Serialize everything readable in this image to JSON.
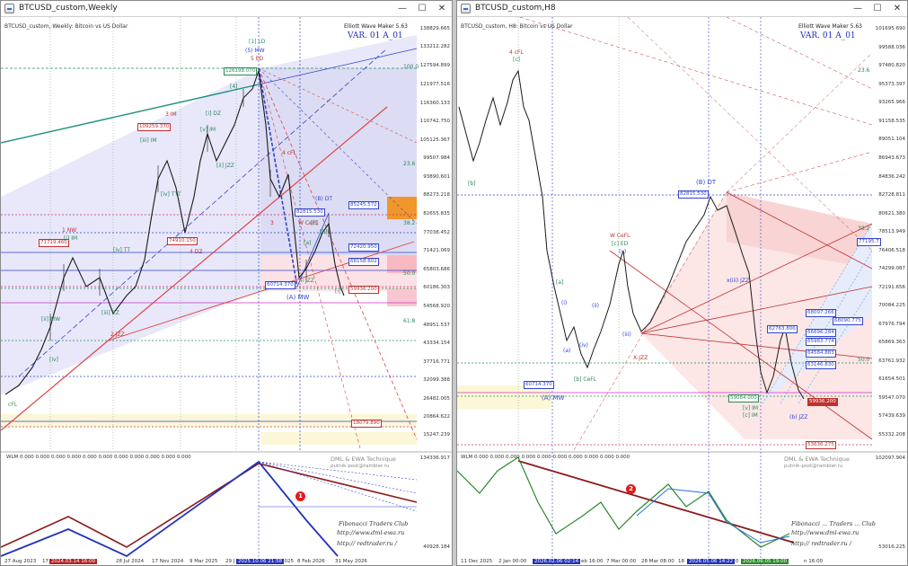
{
  "left": {
    "title": "BTCUSD_custom,Weekly",
    "header": "BTCUSD_custom, Weekly:  Bitcoin vs US Dollar",
    "ewm": "Elliott Wave Maker 5.63",
    "var": "VAR. 01 A_01",
    "prices": [
      "138829.665",
      "133212.282",
      "127594.899",
      "121977.516",
      "116360.133",
      "110742.750",
      "105125.367",
      "99507.984",
      "93890.601",
      "88273.218",
      "82655.835",
      "77038.452",
      "71421.069",
      "65803.686",
      "60186.303",
      "54568.920",
      "48951.537",
      "43334.154",
      "37716.771",
      "32099.388",
      "26482.005",
      "20864.622",
      "15247.239"
    ],
    "fib": [
      "100.0",
      "23.6",
      "38.2",
      "50.0",
      "61.8"
    ],
    "dates": [
      "27 Aug 2023",
      "17",
      "2024.03.14 16:00",
      "28 Jul 2024",
      "17 Nov 2024",
      "9 Mar 2025",
      "29 J",
      "2025.10.06 21:58",
      "2025",
      "8 Feb 2026",
      "31 May 2026"
    ],
    "boxes": {
      "b1": "126198.070",
      "b2": "109259.370",
      "b3": "71719.460",
      "b4": "74910.150",
      "b5": "82815.530",
      "b6": "85245.572",
      "b7": "72420.950",
      "b8": "68158.602",
      "b9": "60714.370",
      "b10": "59936.200",
      "b11": "18079.890"
    },
    "waves": {
      "w1": "[1] LD",
      "w2": "(5) MW",
      "w3": "5 ED",
      "w4": "3 IM",
      "w5": "[iii] IM",
      "w6": "[i] DZ",
      "w7": "[ii] JZZ",
      "w8": "[iv] TTT",
      "w9": "1 NW",
      "w10": "[i] IM",
      "w11": "4 cFL",
      "w12": "(B) DT",
      "w13": "W CeFL",
      "w14": "(A) MW",
      "w15": "2 JZZ",
      "w16": "[ii] MW",
      "w17": "4 DZ",
      "w18": "[iii] ZZ",
      "w19": "[iv] TT",
      "w20": "[v] IM",
      "w21": "cFL",
      "w22": "3",
      "w23": "iii JZZ",
      "w24": "[4]",
      "w25": "[iv]",
      "w26": "[b]",
      "w27": "[c]",
      "w28": "[a]",
      "w29": "[i]"
    },
    "ind_label": "WLM 0.000 0.000 0.000 0.000 0.000 0.000 0.000 0.000 0.000 0.000 0.000",
    "ind_prices": [
      "134336.917",
      "40928.184"
    ],
    "credit": {
      "a": "DML & EWA Technique",
      "b": "putnik-post@rambler.ru",
      "c": "Fibonacci    Traders    Club",
      "d": "http://www.dml-ewa.ru",
      "e": "http:// redtrader.ru /"
    },
    "marker": "1"
  },
  "right": {
    "title": "BTCUSD_custom,H8",
    "header": "BTCUSD_custom, H8:  Bitcoin vs US Dollar",
    "ewm": "Elliott Wave Maker 5.63",
    "var": "VAR. 01 A_01",
    "prices": [
      "101695.690",
      "99588.036",
      "97480.820",
      "95373.397",
      "93265.966",
      "91158.535",
      "89051.104",
      "86943.673",
      "84836.242",
      "82728.811",
      "80621.380",
      "78513.949",
      "76406.518",
      "74299.087",
      "72191.656",
      "70084.225",
      "67976.794",
      "65869.363",
      "63761.932",
      "61654.501",
      "59547.070",
      "57439.639",
      "55332.208"
    ],
    "fib": [
      "23.6",
      "38.2",
      "50.0"
    ],
    "dates": [
      "11 Dec 2025",
      "2 Jan 00:00",
      "2026.02.06 02:14",
      "eb 16:00",
      "7 Mar 00:00",
      "28 Mar 08:00",
      "18",
      "2026.05.06 14:22",
      "0",
      "2026.06.05 19:00",
      "n 16:00"
    ],
    "boxes": {
      "b1": "82815.530",
      "b2": "60714.370",
      "b3": "59084.000",
      "b4": "68097.266",
      "b5": "68090.775",
      "b6": "66696.284",
      "b7": "65983.774",
      "b8": "64584.883",
      "b9": "63146.830",
      "b10": "62763.806",
      "b11": "59936.200",
      "b12": "53636.275",
      "b13": "77195.7"
    },
    "waves": {
      "w1": "4 cFL",
      "w2": "[c]",
      "w3": "(B) DT",
      "w4": "W CeFL",
      "w5": "[c] ED",
      "w6": "X-JZZ",
      "w7": "(A) MW",
      "w8": "[b] CeFL",
      "w9": "[b]",
      "w10": "[a]",
      "w11": "(iv)",
      "w12": "(i)",
      "w13": "(a)",
      "w14": "(v)",
      "w15": "(iii)",
      "w16": "(ii)",
      "w17": "[v] IM",
      "w18": "[c] IM",
      "w19": "(b) JZZ",
      "w20": "x(iii) JZZ"
    },
    "ind_label": "WLM 0.000 0.000 0.000 0.000 0.000 0.000 0.000 0.000 0.000 0.000",
    "ind_prices": [
      "102097.904",
      "53016.225"
    ],
    "credit": {
      "a": "DML & EWA Technique",
      "b": "putnik-post@rambler.ru",
      "c": "Fibonacci ... Traders ... Club",
      "d": "http://www.dml-ewa.ru",
      "e": "http:// redtrader.ru /"
    },
    "marker": "2"
  },
  "window_buttons": {
    "min": "—",
    "max": "☐",
    "close": "✕"
  }
}
